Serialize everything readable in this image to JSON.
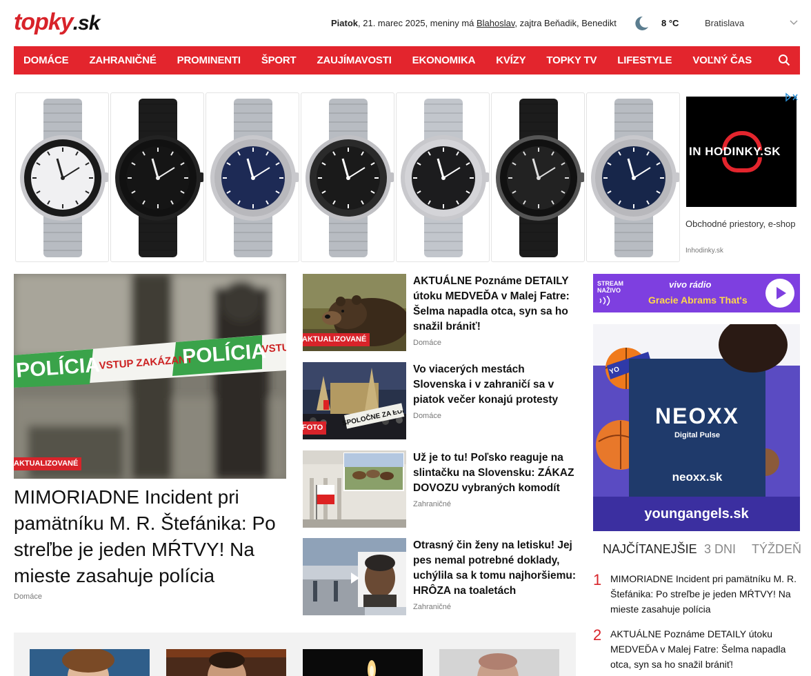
{
  "header": {
    "logo_part1": "topky",
    "logo_part2": ".sk",
    "day": "Piatok",
    "date_rest": ", 21. marec 2025, meniny má ",
    "nameday": "Blahoslav",
    "tomorrow": ", zajtra Beňadik, Benedikt",
    "temperature": "8 °C",
    "city": "Bratislava"
  },
  "nav": {
    "items": [
      "DOMÁCE",
      "ZAHRANIČNÉ",
      "PROMINENTI",
      "ŠPORT",
      "ZAUJÍMAVOSTI",
      "EKONOMIKA",
      "KVÍZY",
      "TOPKY TV",
      "LIFESTYLE",
      "VOĽNÝ ČAS"
    ]
  },
  "ad": {
    "brand": "IN HODINKY.SK",
    "description": "Obchodné priestory, e-shop",
    "source": "Inhodinky.sk"
  },
  "main_article": {
    "image_caption": "POLÍCIA   VSTUP ZAKÁZANÝ   POLÍCIA   VSTUP",
    "badge": "AKTUALIZOVANÉ",
    "title": "MIMORIADNE Incident pri pamätníku M. R. Štefánika: Po streľbe je jeden MŔTVY! Na mieste zasahuje polícia",
    "category": "Domáce"
  },
  "articles": [
    {
      "badge": "AKTUALIZOVANÉ",
      "title": "AKTUÁLNE Poznáme DETAILY útoku MEDVEĎA v Malej Fatre: Šelma napadla otca, syn sa ho snažil brániť!",
      "category": "Domáce"
    },
    {
      "badge": "FOTO",
      "sign": "SPOLOČNE ZA EURÓPU",
      "title": "Vo viacerých mestách Slovenska i v zahraničí sa v piatok večer konajú protesty",
      "category": "Domáce"
    },
    {
      "badge": "",
      "title": "Už je to tu! Poľsko reaguje na slintačku na Slovensku: ZÁKAZ DOVOZU vybraných komodít",
      "category": "Zahraničné"
    },
    {
      "badge": "",
      "title": "Otrasný čin ženy na letisku! Jej pes nemal potrebné doklady, uchýlila sa k tomu najhoršiemu: HRÔZA na toaletách",
      "category": "Zahraničné"
    }
  ],
  "radio_ad": {
    "stream_label_1": "STREAM",
    "stream_label_2": "NAŽIVO",
    "station": "vivo rádio",
    "song": "Gracie Abrams That's"
  },
  "neoxx_ad": {
    "brand": "NEOXX",
    "tagline": "Digital Pulse",
    "url": "neoxx.sk",
    "footer": "youngangels.sk",
    "ball_text": "YO"
  },
  "most_read": {
    "tabs": [
      "NAJČÍTANEJŠIE",
      "3 DNI",
      "TÝŽDEŇ"
    ],
    "items": [
      {
        "rank": "1",
        "title": "MIMORIADNE Incident pri pamätníku M. R. Štefánika: Po streľbe je jeden MŔTVY! Na mieste zasahuje polícia"
      },
      {
        "rank": "2",
        "title": "AKTUÁLNE Poznáme DETAILY útoku MEDVEĎA v Malej Fatre: Šelma napadla otca, syn sa ho snažil brániť!"
      }
    ]
  },
  "colors": {
    "brand_red": "#e3252d",
    "radio_purple": "#7e3fe0",
    "neoxx_blue": "#1f3a6b"
  }
}
